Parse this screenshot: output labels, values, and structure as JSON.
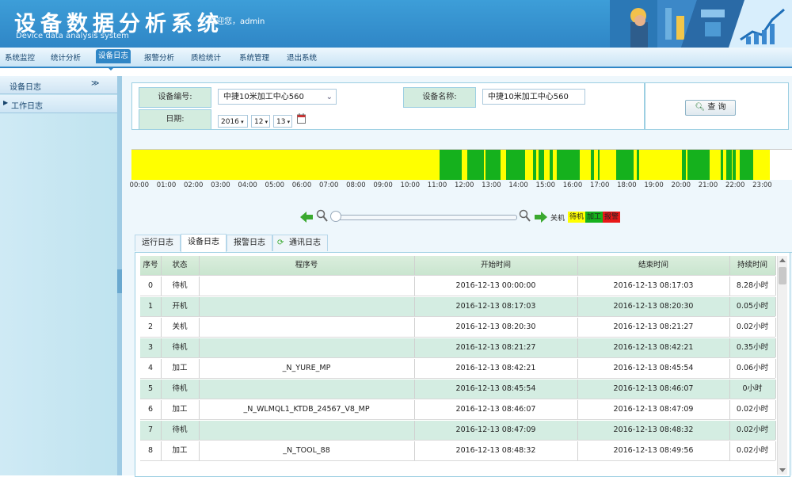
{
  "header": {
    "title": "设备数据分析系统",
    "subtitle": "Device data analysis system",
    "welcome": "欢迎您，admin"
  },
  "nav": {
    "items": [
      {
        "label": "系统监控",
        "active": false
      },
      {
        "label": "统计分析",
        "active": false
      },
      {
        "label": "设备日志",
        "active": true
      },
      {
        "label": "报警分析",
        "active": false
      },
      {
        "label": "质检统计",
        "active": false
      },
      {
        "label": "系统管理",
        "active": false
      },
      {
        "label": "退出系统",
        "active": false
      }
    ]
  },
  "sidebar": {
    "title": "设备日志",
    "collapse": "≫",
    "items": [
      {
        "label": "工作日志"
      }
    ]
  },
  "form": {
    "device_no_label": "设备编号:",
    "device_no_value": "中捷10米加工中心560",
    "device_name_label": "设备名称:",
    "device_name_value": "中捷10米加工中心560",
    "date_label": "日期:",
    "year": "2016",
    "month": "12",
    "day": "13",
    "query_label": "查 询"
  },
  "timeline": {
    "ticks": [
      "00:00",
      "01:00",
      "02:00",
      "03:00",
      "04:00",
      "05:00",
      "06:00",
      "07:00",
      "08:00",
      "09:00",
      "10:00",
      "11:00",
      "12:00",
      "13:00",
      "14:00",
      "15:00",
      "16:00",
      "17:00",
      "18:00",
      "19:00",
      "20:00",
      "21:00",
      "22:00",
      "23:00"
    ],
    "green_segments": [
      [
        11.2,
        12.0
      ],
      [
        12.2,
        12.8
      ],
      [
        12.85,
        13.4
      ],
      [
        13.6,
        14.3
      ],
      [
        14.6,
        14.7
      ],
      [
        14.8,
        15.0
      ],
      [
        15.2,
        15.3
      ],
      [
        15.45,
        16.3
      ],
      [
        16.7,
        16.8
      ],
      [
        16.95,
        17.0
      ],
      [
        17.6,
        18.25
      ],
      [
        18.35,
        18.45
      ],
      [
        20.0,
        20.15
      ],
      [
        20.2,
        21.0
      ],
      [
        21.4,
        21.5
      ],
      [
        21.6,
        21.8
      ],
      [
        21.85,
        21.95
      ],
      [
        22.1,
        22.6
      ],
      [
        23.4,
        23.6
      ]
    ],
    "gray_segments": [
      [
        23.2,
        24.0
      ]
    ],
    "colors": {
      "standby": "#ffff00",
      "process": "#15b11d",
      "alarm": "#e81818"
    }
  },
  "zoom": {
    "legend_prefix": "关机",
    "legend": [
      {
        "label": "待机",
        "color": "#ffff00"
      },
      {
        "label": "加工",
        "color": "#15b11d"
      },
      {
        "label": "报警",
        "color": "#e81818"
      }
    ]
  },
  "tabs": [
    {
      "label": "运行日志",
      "active": false
    },
    {
      "label": "设备日志",
      "active": true
    },
    {
      "label": "报警日志",
      "active": false
    },
    {
      "label": "通讯日志",
      "active": false
    }
  ],
  "table": {
    "columns": [
      "序号",
      "状态",
      "程序号",
      "开始时间",
      "结束时间",
      "持续时间"
    ],
    "rows": [
      [
        "0",
        "待机",
        "",
        "2016-12-13 00:00:00",
        "2016-12-13 08:17:03",
        "8.28小时"
      ],
      [
        "1",
        "开机",
        "",
        "2016-12-13 08:17:03",
        "2016-12-13 08:20:30",
        "0.05小时"
      ],
      [
        "2",
        "关机",
        "",
        "2016-12-13 08:20:30",
        "2016-12-13 08:21:27",
        "0.02小时"
      ],
      [
        "3",
        "待机",
        "",
        "2016-12-13 08:21:27",
        "2016-12-13 08:42:21",
        "0.35小时"
      ],
      [
        "4",
        "加工",
        "_N_YURE_MP",
        "2016-12-13 08:42:21",
        "2016-12-13 08:45:54",
        "0.06小时"
      ],
      [
        "5",
        "待机",
        "",
        "2016-12-13 08:45:54",
        "2016-12-13 08:46:07",
        "0小时"
      ],
      [
        "6",
        "加工",
        "_N_WLMQL1_KTDB_24567_V8_MP",
        "2016-12-13 08:46:07",
        "2016-12-13 08:47:09",
        "0.02小时"
      ],
      [
        "7",
        "待机",
        "",
        "2016-12-13 08:47:09",
        "2016-12-13 08:48:32",
        "0.02小时"
      ],
      [
        "8",
        "加工",
        "_N_TOOL_88",
        "2016-12-13 08:48:32",
        "2016-12-13 08:49:56",
        "0.02小时"
      ]
    ]
  }
}
